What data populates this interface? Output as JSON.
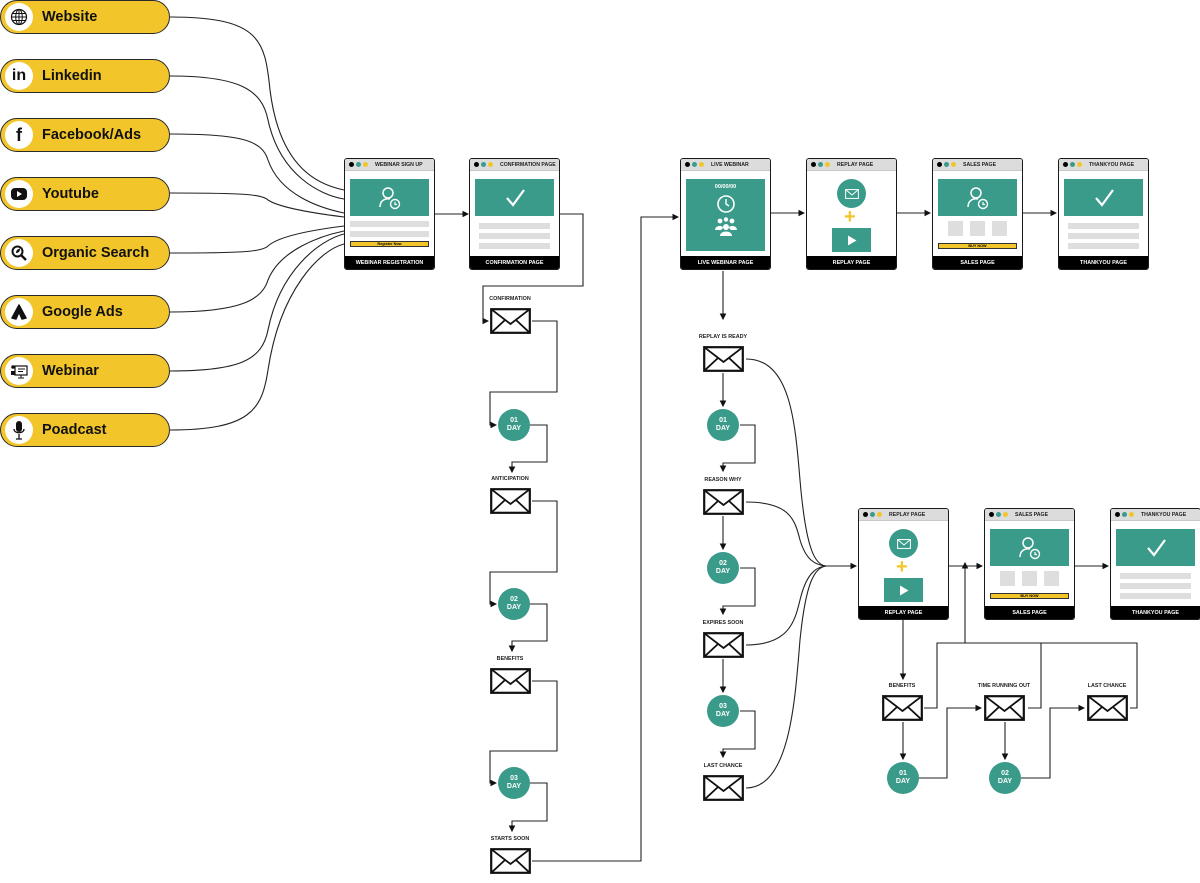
{
  "colors": {
    "accent_yellow": "#f2c62a",
    "accent_teal": "#3a9b8a",
    "dark": "#000000",
    "placeholder_gray": "#dedede"
  },
  "sources": [
    {
      "label": "Website",
      "icon": "globe-icon"
    },
    {
      "label": "Linkedin",
      "icon": "linkedin-icon"
    },
    {
      "label": "Facebook/Ads",
      "icon": "facebook-icon"
    },
    {
      "label": "Youtube",
      "icon": "youtube-icon"
    },
    {
      "label": "Organic Search",
      "icon": "organic-search-icon"
    },
    {
      "label": "Google Ads",
      "icon": "google-ads-icon"
    },
    {
      "label": "Webinar",
      "icon": "webinar-icon"
    },
    {
      "label": "Poadcast",
      "icon": "microphone-icon"
    }
  ],
  "pages": {
    "signup": {
      "title": "WEBINAR SIGN UP",
      "footer": "WEBINAR REGISTRATION",
      "cta": "Register Now"
    },
    "confirmation": {
      "title": "CONFIRMATION PAGE",
      "footer": "CONFIRMATION PAGE"
    },
    "live": {
      "title": "LIVE WEBINAR",
      "footer": "LIVE WEBINAR PAGE",
      "timer": "00/00/00"
    },
    "replay1": {
      "title": "REPLAY PAGE",
      "footer": "REPLAY PAGE"
    },
    "sales1": {
      "title": "SALES PAGE",
      "footer": "SALES PAGE",
      "cta": "BUY NOW"
    },
    "thanks1": {
      "title": "THANKYOU PAGE",
      "footer": "THANKYOU PAGE"
    },
    "replay2": {
      "title": "REPLAY PAGE",
      "footer": "REPLAY PAGE"
    },
    "sales2": {
      "title": "SALES PAGE",
      "footer": "SALES PAGE",
      "cta": "BUY NOW"
    },
    "thanks2": {
      "title": "THANKYOU PAGE",
      "footer": "THANKYOU PAGE"
    }
  },
  "emails": {
    "pre": [
      "CONFIRMATION",
      "ANTICIPATION",
      "BENEFITS",
      "STARTS SOON"
    ],
    "post": [
      "REPLAY IS READY",
      "REASON WHY",
      "EXPIRES SOON",
      "LAST CHANCE"
    ],
    "sales": [
      "BENEFITS",
      "TIME RUNNING OUT",
      "LAST CHANCE"
    ]
  },
  "delays": {
    "pre": [
      {
        "num": "01",
        "unit": "DAY"
      },
      {
        "num": "02",
        "unit": "DAY"
      },
      {
        "num": "03",
        "unit": "DAY"
      }
    ],
    "post": [
      {
        "num": "01",
        "unit": "DAY"
      },
      {
        "num": "02",
        "unit": "DAY"
      },
      {
        "num": "03",
        "unit": "DAY"
      }
    ],
    "sales": [
      {
        "num": "01",
        "unit": "DAY"
      },
      {
        "num": "02",
        "unit": "DAY"
      }
    ]
  }
}
